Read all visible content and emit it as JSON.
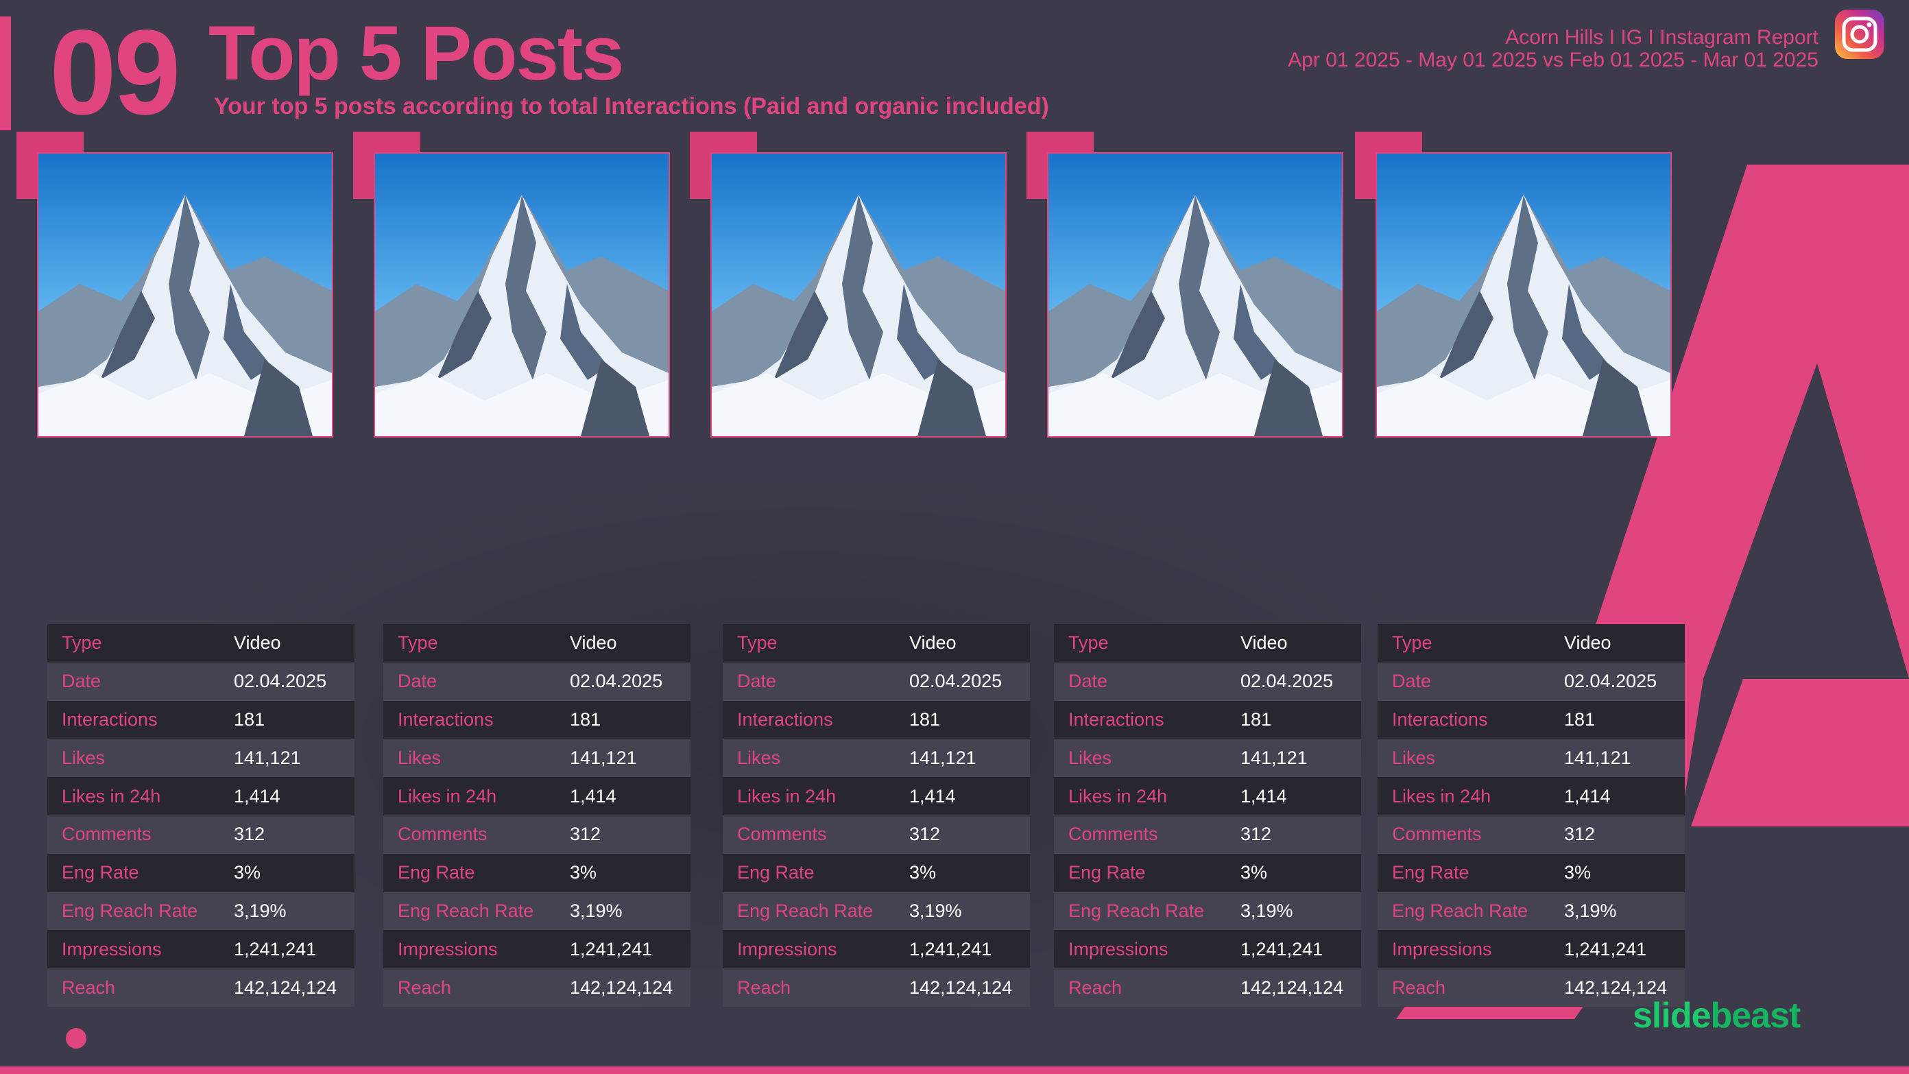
{
  "header": {
    "section_number": "09",
    "title": "Top 5 Posts",
    "subtitle": "Your top 5 posts according to total Interactions (Paid and organic included)",
    "report_title": "Acorn Hills I IG I Instagram Report",
    "date_range": "Apr 01 2025 - May 01 2025 vs Feb 01 2025 - Mar 01 2025",
    "platform_icon": "instagram-icon"
  },
  "colors": {
    "background": "#3d3b4b",
    "accent": "#e0457f",
    "brand_green": "#1ec96d"
  },
  "posts": [
    {
      "image": "snowy-mountain-photo",
      "stats": [
        {
          "label": "Type",
          "value": "Video"
        },
        {
          "label": "Date",
          "value": "02.04.2025"
        },
        {
          "label": "Interactions",
          "value": "181"
        },
        {
          "label": "Likes",
          "value": "141,121"
        },
        {
          "label": "Likes in 24h",
          "value": "1,414"
        },
        {
          "label": "Comments",
          "value": "312"
        },
        {
          "label": "Eng Rate",
          "value": "3%"
        },
        {
          "label": "Eng Reach Rate",
          "value": "3,19%"
        },
        {
          "label": "Impressions",
          "value": "1,241,241"
        },
        {
          "label": "Reach",
          "value": "142,124,124"
        }
      ]
    },
    {
      "image": "snowy-mountain-photo",
      "stats": [
        {
          "label": "Type",
          "value": "Video"
        },
        {
          "label": "Date",
          "value": "02.04.2025"
        },
        {
          "label": "Interactions",
          "value": "181"
        },
        {
          "label": "Likes",
          "value": "141,121"
        },
        {
          "label": "Likes in 24h",
          "value": "1,414"
        },
        {
          "label": "Comments",
          "value": "312"
        },
        {
          "label": "Eng Rate",
          "value": "3%"
        },
        {
          "label": "Eng Reach Rate",
          "value": "3,19%"
        },
        {
          "label": "Impressions",
          "value": "1,241,241"
        },
        {
          "label": "Reach",
          "value": "142,124,124"
        }
      ]
    },
    {
      "image": "snowy-mountain-photo",
      "stats": [
        {
          "label": "Type",
          "value": "Video"
        },
        {
          "label": "Date",
          "value": "02.04.2025"
        },
        {
          "label": "Interactions",
          "value": "181"
        },
        {
          "label": "Likes",
          "value": "141,121"
        },
        {
          "label": "Likes in 24h",
          "value": "1,414"
        },
        {
          "label": "Comments",
          "value": "312"
        },
        {
          "label": "Eng Rate",
          "value": "3%"
        },
        {
          "label": "Eng Reach Rate",
          "value": "3,19%"
        },
        {
          "label": "Impressions",
          "value": "1,241,241"
        },
        {
          "label": "Reach",
          "value": "142,124,124"
        }
      ]
    },
    {
      "image": "snowy-mountain-photo",
      "stats": [
        {
          "label": "Type",
          "value": "Video"
        },
        {
          "label": "Date",
          "value": "02.04.2025"
        },
        {
          "label": "Interactions",
          "value": "181"
        },
        {
          "label": "Likes",
          "value": "141,121"
        },
        {
          "label": "Likes in 24h",
          "value": "1,414"
        },
        {
          "label": "Comments",
          "value": "312"
        },
        {
          "label": "Eng Rate",
          "value": "3%"
        },
        {
          "label": "Eng Reach Rate",
          "value": "3,19%"
        },
        {
          "label": "Impressions",
          "value": "1,241,241"
        },
        {
          "label": "Reach",
          "value": "142,124,124"
        }
      ]
    },
    {
      "image": "snowy-mountain-photo",
      "stats": [
        {
          "label": "Type",
          "value": "Video"
        },
        {
          "label": "Date",
          "value": "02.04.2025"
        },
        {
          "label": "Interactions",
          "value": "181"
        },
        {
          "label": "Likes",
          "value": "141,121"
        },
        {
          "label": "Likes in 24h",
          "value": "1,414"
        },
        {
          "label": "Comments",
          "value": "312"
        },
        {
          "label": "Eng Rate",
          "value": "3%"
        },
        {
          "label": "Eng Reach Rate",
          "value": "3,19%"
        },
        {
          "label": "Impressions",
          "value": "1,241,241"
        },
        {
          "label": "Reach",
          "value": "142,124,124"
        }
      ]
    }
  ],
  "footer": {
    "brand_part1": "slide",
    "brand_part2": "beast"
  }
}
